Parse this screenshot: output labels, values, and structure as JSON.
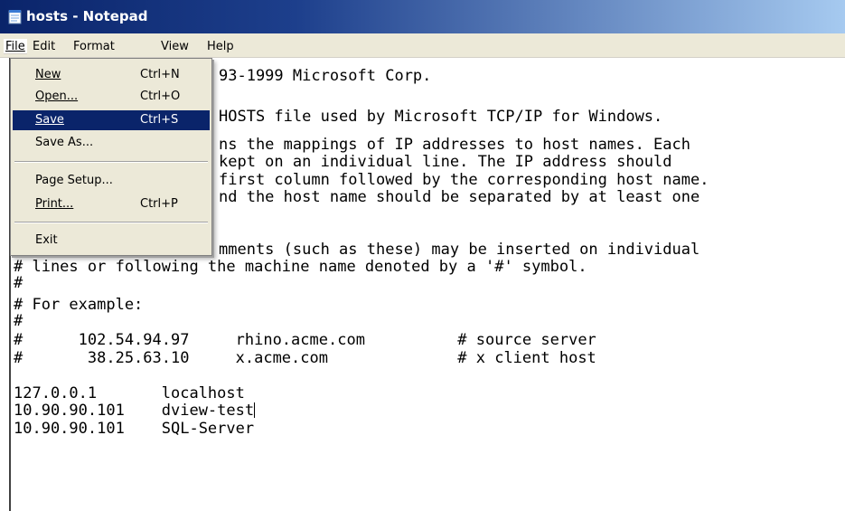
{
  "window": {
    "title": "hosts - Notepad",
    "icon": "notepad-icon"
  },
  "menubar": {
    "file": "File",
    "edit": "Edit",
    "format": "Format",
    "view": "View",
    "help": "Help"
  },
  "file_menu": {
    "new": {
      "label": "New",
      "shortcut": "Ctrl+N"
    },
    "open": {
      "label": "Open...",
      "shortcut": "Ctrl+O"
    },
    "save": {
      "label": "Save",
      "shortcut": "Ctrl+S"
    },
    "save_as": {
      "label": "Save As..."
    },
    "page_setup": {
      "label": "Page Setup..."
    },
    "print": {
      "label": "Print...",
      "shortcut": "Ctrl+P"
    },
    "exit": {
      "label": "Exit"
    },
    "selected_item": "Save"
  },
  "editor": {
    "lines": [
      "93-1999 Microsoft Corp.",
      "HOSTS file used by Microsoft TCP/IP for Windows.",
      "ns the mappings of IP addresses to host names. Each",
      "kept on an individual line. The IP address should",
      "first column followed by the corresponding host name.",
      "nd the host name should be separated by at least one",
      "mments (such as these) may be inserted on individual",
      "# lines or following the machine name denoted by a '#' symbol.",
      "#",
      "# For example:",
      "#",
      "#      102.54.94.97     rhino.acme.com          # source server",
      "#       38.25.63.10     x.acme.com              # x client host",
      "127.0.0.1       localhost",
      "10.90.90.101    dview-test",
      "10.90.90.101    SQL-Server"
    ]
  }
}
